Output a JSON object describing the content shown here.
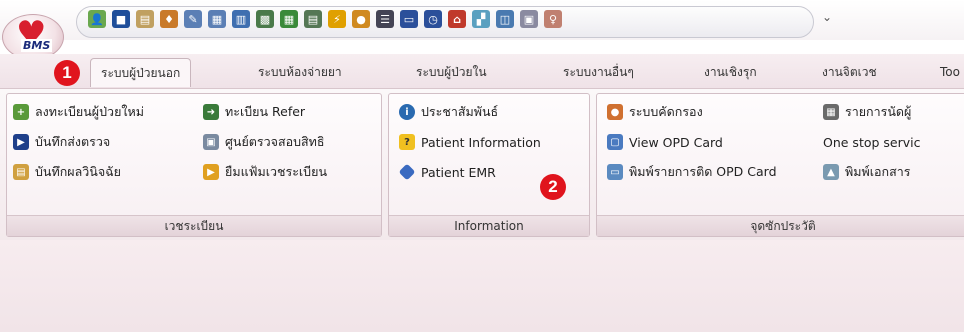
{
  "app": {
    "orb_text": "BMS"
  },
  "quick_access": {
    "icons": [
      {
        "name": "add-user-icon",
        "glyph": "👤",
        "color": "#6aa84f"
      },
      {
        "name": "stop-icon",
        "glyph": "■",
        "color": "#1f4e9a"
      },
      {
        "name": "clipboard-icon",
        "glyph": "▤",
        "color": "#c0a060"
      },
      {
        "name": "doctor-icon",
        "glyph": "♦",
        "color": "#c97a2a"
      },
      {
        "name": "edit-pen-icon",
        "glyph": "✎",
        "color": "#5b7fb5"
      },
      {
        "name": "form-icon",
        "glyph": "▦",
        "color": "#5b7fb5"
      },
      {
        "name": "document-icon",
        "glyph": "▥",
        "color": "#3f6fb0"
      },
      {
        "name": "calculator-icon",
        "glyph": "▩",
        "color": "#4a7a4a"
      },
      {
        "name": "spreadsheet-icon",
        "glyph": "▦",
        "color": "#3a8a3a"
      },
      {
        "name": "table-icon",
        "glyph": "▤",
        "color": "#557755"
      },
      {
        "name": "lightning-icon",
        "glyph": "⚡",
        "color": "#e0a000"
      },
      {
        "name": "person-icon",
        "glyph": "●",
        "color": "#d08a20"
      },
      {
        "name": "list-icon",
        "glyph": "☰",
        "color": "#445"
      },
      {
        "name": "monitor-icon",
        "glyph": "▭",
        "color": "#2b4f9a"
      },
      {
        "name": "clock-icon",
        "glyph": "◷",
        "color": "#2b4f9a"
      },
      {
        "name": "home-icon",
        "glyph": "⌂",
        "color": "#c0392b"
      },
      {
        "name": "chart-icon",
        "glyph": "▞",
        "color": "#5aa0c0"
      },
      {
        "name": "network-icon",
        "glyph": "◫",
        "color": "#4a7ab0"
      },
      {
        "name": "card-icon",
        "glyph": "▣",
        "color": "#8a8aa0"
      },
      {
        "name": "nurse-icon",
        "glyph": "♀",
        "color": "#c08070"
      }
    ],
    "dropdown": "⌄"
  },
  "tabs": [
    {
      "name": "tab-outpatient",
      "label": "ระบบผู้ป่วยนอก",
      "active": true
    },
    {
      "name": "tab-pharmacy",
      "label": "ระบบห้องจ่ายยา"
    },
    {
      "name": "tab-inpatient",
      "label": "ระบบผู้ป่วยใน"
    },
    {
      "name": "tab-other",
      "label": "ระบบงานอื่นๆ"
    },
    {
      "name": "tab-proactive",
      "label": "งานเชิงรุก"
    },
    {
      "name": "tab-psychiatry",
      "label": "งานจิตเวช"
    },
    {
      "name": "tab-tools",
      "label": "Too"
    }
  ],
  "groups": {
    "registry": {
      "label": "เวชระเบียน",
      "commands": [
        {
          "label": "ลงทะเบียนผู้ป่วยใหม่",
          "icon": "add-patient-icon"
        },
        {
          "label": "ทะเบียน Refer",
          "icon": "refer-arrow-icon"
        },
        {
          "label": "บันทึกส่งตรวจ",
          "icon": "send-exam-icon"
        },
        {
          "label": "ศูนย์ตรวจสอบสิทธิ",
          "icon": "rights-check-icon"
        },
        {
          "label": "บันทึกผลวินิจฉัย",
          "icon": "diagnosis-icon"
        },
        {
          "label": "ยืมแฟ้มเวชระเบียน",
          "icon": "borrow-folder-icon"
        }
      ]
    },
    "information": {
      "label": "Information",
      "commands": [
        {
          "label": "ประชาสัมพันธ์",
          "icon": "info-icon"
        },
        {
          "label": "Patient Information",
          "icon": "question-icon"
        },
        {
          "label": "Patient EMR",
          "icon": "emr-diamond-icon"
        }
      ]
    },
    "history": {
      "label": "จุดซักประวัติ",
      "commands": [
        {
          "label": "ระบบคัดกรอง",
          "icon": "screening-icon"
        },
        {
          "label": "รายการนัดผู้",
          "icon": "appointment-icon"
        },
        {
          "label": "View OPD Card",
          "icon": "view-card-icon"
        },
        {
          "label": "One stop servic",
          "icon": ""
        },
        {
          "label": "พิมพ์รายการติด OPD Card",
          "icon": "print-list-icon"
        },
        {
          "label": "พิมพ์เอกสาร",
          "icon": "print-doc-icon"
        }
      ]
    }
  },
  "badges": [
    "1",
    "2"
  ]
}
